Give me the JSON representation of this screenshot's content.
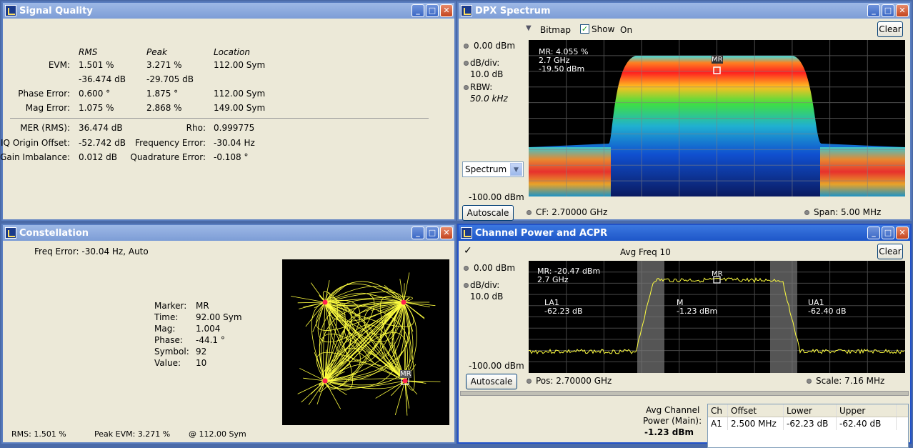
{
  "windows": {
    "signal_quality": {
      "title": "Signal Quality",
      "col_rms": "RMS",
      "col_peak": "Peak",
      "col_location": "Location",
      "evm_label": "EVM:",
      "evm_rms": "1.501 %",
      "evm_peak": "3.271 %",
      "evm_loc": "112.00 Sym",
      "evm_rms_db": "-36.474 dB",
      "evm_peak_db": "-29.705 dB",
      "phase_label": "Phase Error:",
      "phase_rms": "0.600 °",
      "phase_peak": "1.875 °",
      "phase_loc": "112.00 Sym",
      "mag_label": "Mag Error:",
      "mag_rms": "1.075 %",
      "mag_peak": "2.868 %",
      "mag_loc": "149.00 Sym",
      "mer_label": "MER (RMS):",
      "mer_value": "36.474 dB",
      "rho_label": "Rho:",
      "rho_value": "0.999775",
      "iq_label": "IQ Origin Offset:",
      "iq_value": "-52.742 dB",
      "freq_label": "Frequency Error:",
      "freq_value": "-30.04 Hz",
      "gain_label": "Gain Imbalance:",
      "gain_value": "0.012 dB",
      "quad_label": "Quadrature Error:",
      "quad_value": "-0.108 °"
    },
    "dpx": {
      "title": "DPX Spectrum",
      "bitmap_label": "Bitmap",
      "show_label": "Show",
      "on_label": "On",
      "clear_label": "Clear",
      "ref_level": "0.00 dBm",
      "dbdiv_label": "dB/div:",
      "dbdiv_value": "10.0 dB",
      "rbw_label": "RBW:",
      "rbw_value": "50.0 kHz",
      "mode_select": "Spectrum",
      "bottom_level": "-100.00 dBm",
      "autoscale_label": "Autoscale",
      "cf_label": "CF: 2.70000 GHz",
      "span_label": "Span: 5.00 MHz",
      "marker_l1": "MR: 4.055 %",
      "marker_l2": "2.7 GHz",
      "marker_l3": "-19.50 dBm",
      "marker_tag": "MR"
    },
    "constellation": {
      "title": "Constellation",
      "freq_error": "Freq Error: -30.04 Hz, Auto",
      "marker_label": "Marker:",
      "marker_value": "MR",
      "time_label": "Time:",
      "time_value": "92.00 Sym",
      "mag_label": "Mag:",
      "mag_value": "1.004",
      "phase_label": "Phase:",
      "phase_value": "-44.1 °",
      "symbol_label": "Symbol:",
      "symbol_value": "92",
      "value_label": "Value:",
      "value_value": "10",
      "rms_footer": "RMS:  1.501 %",
      "peak_footer": "Peak EVM:   3.271 %",
      "at_footer": "@  112.00 Sym",
      "marker_tag": "MR"
    },
    "acpr": {
      "title": "Channel Power and ACPR",
      "check_glyph": "✓",
      "avg_label": "Avg Freq 10",
      "clear_label": "Clear",
      "ref_level": "0.00 dBm",
      "dbdiv_label": "dB/div:",
      "dbdiv_value": "10.0 dB",
      "bottom_level": "-100.00 dBm",
      "autoscale_label": "Autoscale",
      "pos_label": "Pos:  2.70000 GHz",
      "scale_label": "Scale:  7.16 MHz",
      "marker_l1": "MR: -20.47 dBm",
      "marker_l2": "2.7 GHz",
      "marker_tag": "MR",
      "la1_l1": "LA1",
      "la1_l2": "-62.23 dB",
      "m_l1": "M",
      "m_l2": "-1.23 dBm",
      "ua1_l1": "UA1",
      "ua1_l2": "-62.40 dB",
      "avg_power_l1": "Avg Channel",
      "avg_power_l2": "Power (Main):",
      "avg_power_value": "-1.23 dBm",
      "table": {
        "headers": [
          "Ch",
          "Offset",
          "Lower",
          "Upper"
        ],
        "rows": [
          [
            "A1",
            "2.500 MHz",
            "-62.23 dB",
            "-62.40 dB"
          ]
        ]
      }
    }
  },
  "colors": {
    "active_title": "#1e56c8",
    "inactive_title": "#7d9dd6",
    "window_bg": "#ece9d8",
    "trace_yellow": "#ffff40"
  },
  "icons": {
    "minimize": "minimize-icon",
    "maximize": "maximize-icon",
    "close": "close-icon"
  }
}
